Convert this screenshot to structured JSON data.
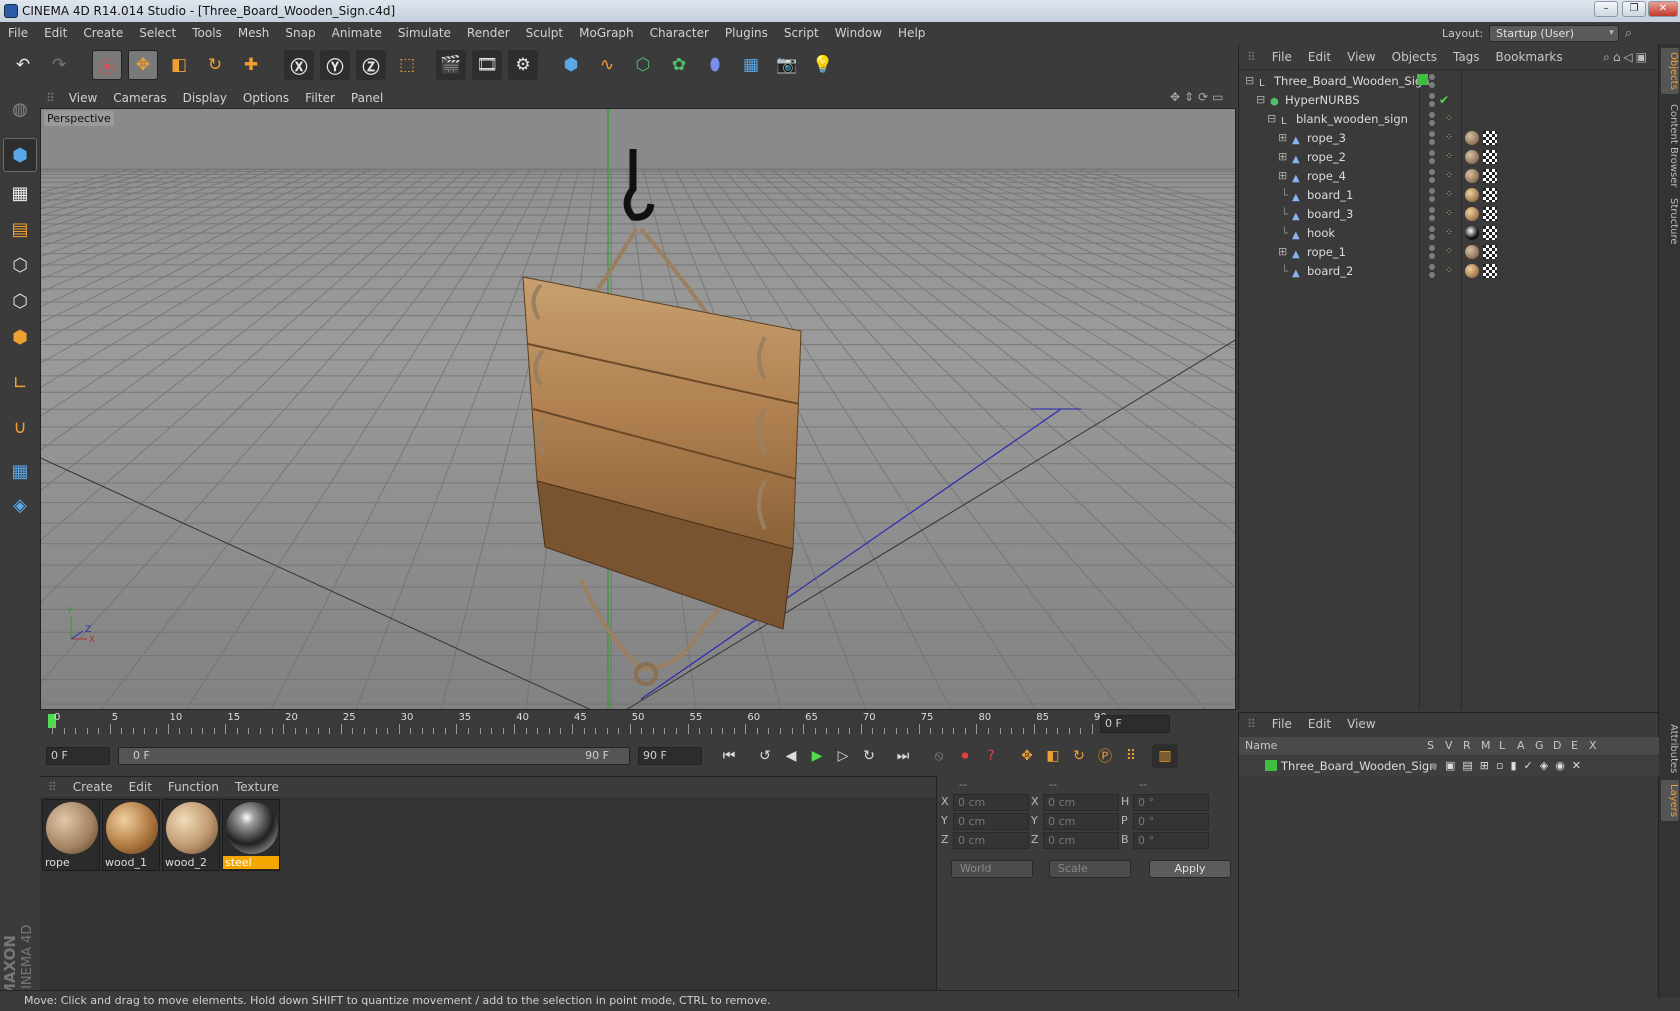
{
  "window": {
    "title": "CINEMA 4D R14.014 Studio - [Three_Board_Wooden_Sign.c4d]"
  },
  "menubar": [
    "File",
    "Edit",
    "Create",
    "Select",
    "Tools",
    "Mesh",
    "Snap",
    "Animate",
    "Simulate",
    "Render",
    "Sculpt",
    "MoGraph",
    "Character",
    "Plugins",
    "Script",
    "Window",
    "Help"
  ],
  "layout": {
    "label": "Layout:",
    "value": "Startup (User)"
  },
  "viewport": {
    "menu": [
      "View",
      "Cameras",
      "Display",
      "Options",
      "Filter",
      "Panel"
    ],
    "label": "Perspective",
    "axes": {
      "y": "Y",
      "z": "Z",
      "x": "X"
    }
  },
  "timeline": {
    "ticks": [
      "0",
      "5",
      "10",
      "15",
      "20",
      "25",
      "30",
      "35",
      "40",
      "45",
      "50",
      "55",
      "60",
      "65",
      "70",
      "75",
      "80",
      "85",
      "90"
    ],
    "frame_display": "0 F"
  },
  "playback": {
    "start": "0 F",
    "range_start": "0 F",
    "range_end": "90 F",
    "end": "90 F"
  },
  "materials": {
    "menu": [
      "Create",
      "Edit",
      "Function",
      "Texture"
    ],
    "items": [
      {
        "name": "rope",
        "selected": false
      },
      {
        "name": "wood_1",
        "selected": false
      },
      {
        "name": "wood_2",
        "selected": false
      },
      {
        "name": "steel",
        "selected": true
      }
    ]
  },
  "coordinates": {
    "header": [
      "--",
      "--",
      "--"
    ],
    "rows": [
      {
        "l1": "X",
        "v1": "0 cm",
        "l2": "X",
        "v2": "0 cm",
        "l3": "H",
        "v3": "0 °"
      },
      {
        "l1": "Y",
        "v1": "0 cm",
        "l2": "Y",
        "v2": "0 cm",
        "l3": "P",
        "v3": "0 °"
      },
      {
        "l1": "Z",
        "v1": "0 cm",
        "l2": "Z",
        "v2": "0 cm",
        "l3": "B",
        "v3": "0 °"
      }
    ],
    "space": "World",
    "mode": "Scale",
    "apply": "Apply"
  },
  "objects": {
    "menu": [
      "File",
      "Edit",
      "View",
      "Objects",
      "Tags",
      "Bookmarks"
    ],
    "items": [
      {
        "name": "Three_Board_Wooden_Sign",
        "type": "null",
        "expander": "⊟",
        "tag": "none"
      },
      {
        "name": "HyperNURBS",
        "type": "hypernurbs",
        "expander": "⊟",
        "tag": "none"
      },
      {
        "name": "blank_wooden_sign",
        "type": "null",
        "expander": "⊟",
        "tag": "none"
      },
      {
        "name": "rope_3",
        "type": "mesh",
        "expander": "⊞",
        "tag": "rope"
      },
      {
        "name": "rope_2",
        "type": "mesh",
        "expander": "⊞",
        "tag": "rope"
      },
      {
        "name": "rope_4",
        "type": "mesh",
        "expander": "⊞",
        "tag": "rope"
      },
      {
        "name": "board_1",
        "type": "mesh",
        "expander": "",
        "tag": "wood"
      },
      {
        "name": "board_3",
        "type": "mesh",
        "expander": "",
        "tag": "wood"
      },
      {
        "name": "hook",
        "type": "mesh",
        "expander": "",
        "tag": "steel"
      },
      {
        "name": "rope_1",
        "type": "mesh",
        "expander": "⊞",
        "tag": "rope"
      },
      {
        "name": "board_2",
        "type": "mesh",
        "expander": "",
        "tag": "wood"
      }
    ]
  },
  "layers": {
    "menu": [
      "File",
      "Edit",
      "View"
    ],
    "columns": [
      "Name",
      "S",
      "V",
      "R",
      "M",
      "L",
      "A",
      "G",
      "D",
      "E",
      "X"
    ],
    "items": [
      {
        "name": "Three_Board_Wooden_Sign",
        "color": "#3fbf3f"
      }
    ]
  },
  "sidetabs": {
    "top": [
      "Objects",
      "Content Browser",
      "Structure"
    ],
    "bottom": [
      "Attributes",
      "Layers"
    ]
  },
  "branding": {
    "maxon": "MAXON",
    "product": "CINEMA 4D"
  },
  "status": "Move: Click and drag to move elements. Hold down SHIFT to quantize movement / add to the selection in point mode, CTRL to remove.",
  "colors": {
    "accent": "#f0a030",
    "selection": "#f5a700",
    "layer_green": "#3fbf3f"
  }
}
